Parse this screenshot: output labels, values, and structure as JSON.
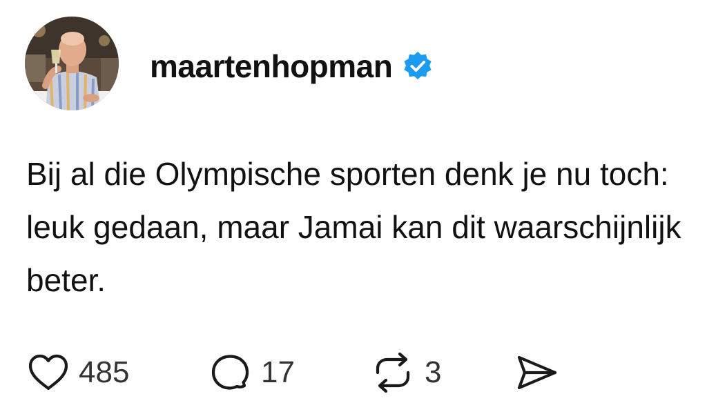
{
  "post": {
    "author": {
      "username": "maartenhopman",
      "verified": true,
      "avatar_icon": "profile-photo"
    },
    "text": "Bij al die Olympische sporten denk je nu toch: leuk gedaan, maar Jamai kan dit waarschijnlijk beter.",
    "actions": {
      "like_count": "485",
      "reply_count": "17",
      "repost_count": "3"
    }
  },
  "colors": {
    "verified_badge": "#1d9bf0",
    "text": "#111111",
    "count_text": "#333333",
    "background": "#ffffff"
  }
}
